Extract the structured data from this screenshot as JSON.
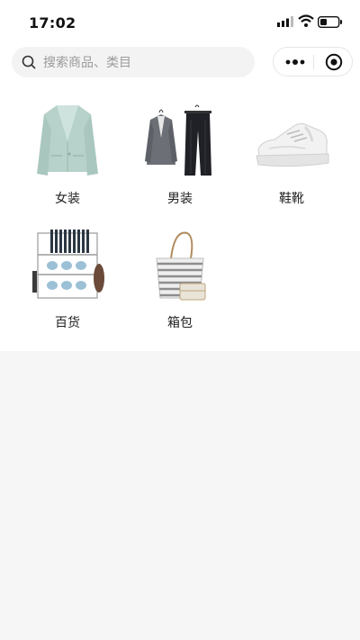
{
  "status": {
    "time": "17:02"
  },
  "search": {
    "placeholder": "搜索商品、类目"
  },
  "categories": [
    {
      "label": "女装",
      "icon": "blazer-image"
    },
    {
      "label": "男装",
      "icon": "suit-image"
    },
    {
      "label": "鞋靴",
      "icon": "sneaker-image"
    },
    {
      "label": "百货",
      "icon": "dish-rack-image"
    },
    {
      "label": "箱包",
      "icon": "tote-bag-image"
    }
  ],
  "colors": {
    "accent": "#111111",
    "page_bg": "#f6f6f6"
  }
}
